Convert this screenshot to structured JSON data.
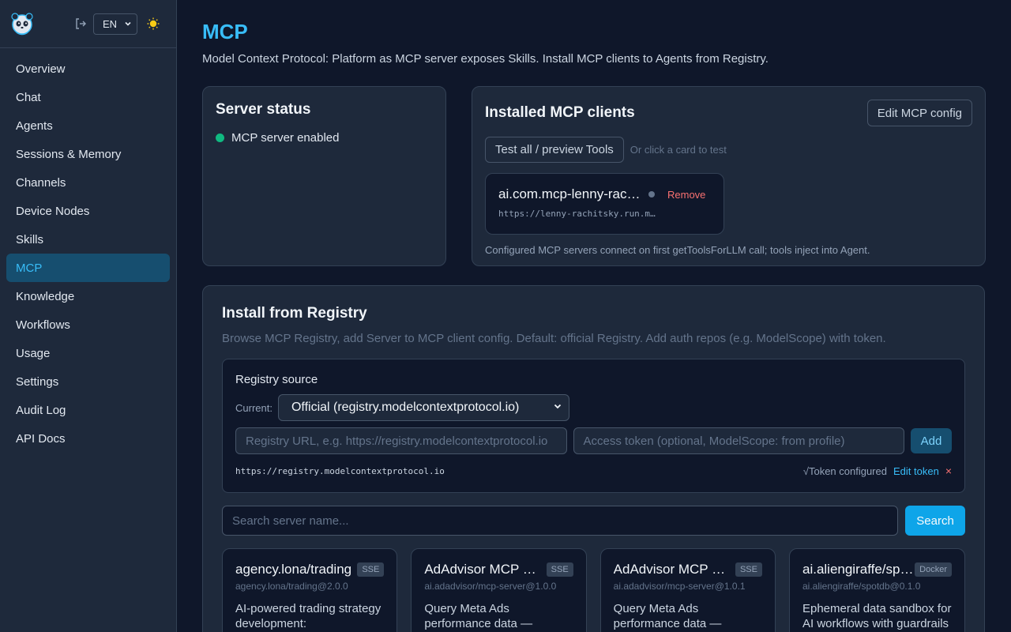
{
  "sidebar": {
    "lang": "EN",
    "items": [
      {
        "label": "Overview"
      },
      {
        "label": "Chat"
      },
      {
        "label": "Agents"
      },
      {
        "label": "Sessions & Memory"
      },
      {
        "label": "Channels"
      },
      {
        "label": "Device Nodes"
      },
      {
        "label": "Skills"
      },
      {
        "label": "MCP"
      },
      {
        "label": "Knowledge"
      },
      {
        "label": "Workflows"
      },
      {
        "label": "Usage"
      },
      {
        "label": "Settings"
      },
      {
        "label": "Audit Log"
      },
      {
        "label": "API Docs"
      }
    ],
    "active_index": 7
  },
  "page": {
    "title": "MCP",
    "subtitle": "Model Context Protocol: Platform as MCP server exposes Skills. Install MCP clients to Agents from Registry."
  },
  "server_status": {
    "title": "Server status",
    "status": "MCP server enabled",
    "status_color": "#10b981"
  },
  "clients": {
    "title": "Installed MCP clients",
    "edit_config": "Edit MCP config",
    "test_all": "Test all / preview Tools",
    "hint": "Or click a card to test",
    "items": [
      {
        "name": "ai.com.mcp-lenny-rachitsky-podcast",
        "url": "https://lenny-rachitsky.run.mcp.com.ai/mcp",
        "remove": "Remove"
      }
    ],
    "footer": "Configured MCP servers connect on first getToolsForLLM call; tools inject into Agent."
  },
  "registry": {
    "title": "Install from Registry",
    "subtitle": "Browse MCP Registry, add Server to MCP client config. Default: official Registry. Add auth repos (e.g. ModelScope) with token.",
    "source_title": "Registry source",
    "current_label": "Current:",
    "current_value": "Official (registry.modelcontextprotocol.io)",
    "url_placeholder": "Registry URL, e.g. https://registry.modelcontextprotocol.io",
    "token_placeholder": "Access token (optional, ModelScope: from profile)",
    "add": "Add",
    "current_url": "https://registry.modelcontextprotocol.io",
    "token_status": "√Token configured",
    "edit_token": "Edit token",
    "remove_token": "×",
    "search_placeholder": "Search server name...",
    "search_button": "Search",
    "servers": [
      {
        "name": "agency.lona/trading",
        "badge": "SSE",
        "id": "agency.lona/trading@2.0.0",
        "desc": "AI-powered trading strategy development:"
      },
      {
        "name": "AdAdvisor MCP Server",
        "badge": "SSE",
        "id": "ai.adadvisor/mcp-server@1.0.0",
        "desc": "Query Meta Ads performance data —"
      },
      {
        "name": "AdAdvisor MCP Server",
        "badge": "SSE",
        "id": "ai.adadvisor/mcp-server@1.0.1",
        "desc": "Query Meta Ads performance data —"
      },
      {
        "name": "ai.aliengiraffe/spotdb",
        "badge": "Docker",
        "id": "ai.aliengiraffe/spotdb@0.1.0",
        "desc": "Ephemeral data sandbox for AI workflows with guardrails"
      }
    ]
  },
  "colors": {
    "accent": "#38bdf8",
    "bg": "#0f172a",
    "panel": "#1e293b",
    "danger": "#f87171"
  }
}
